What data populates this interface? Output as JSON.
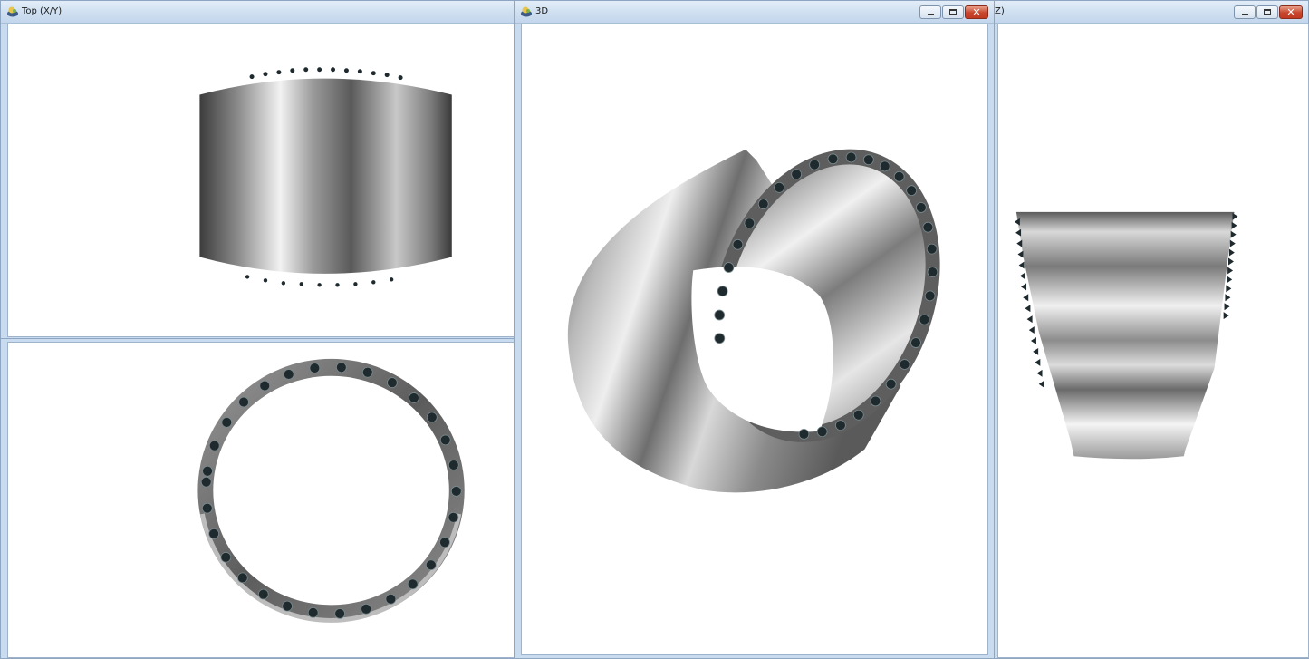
{
  "windows": {
    "top": {
      "title": "Top (X/Y)"
    },
    "front": {
      "title": ""
    },
    "perspective": {
      "title": "3D"
    },
    "side": {
      "title": "Z)"
    }
  },
  "colors": {
    "desktop": "#bcd0e6",
    "viewport_bg": "#ffffff",
    "metal_dark": "#4a4a4a",
    "metal_light": "#f4f4f4",
    "gem": "#1e2a2e",
    "close_button": "#c8452c"
  },
  "icons": {
    "app": "app-icon",
    "minimize": "minimize-icon",
    "maximize": "maximize-icon",
    "close": "close-icon"
  },
  "ring": {
    "stone_count": 40
  }
}
